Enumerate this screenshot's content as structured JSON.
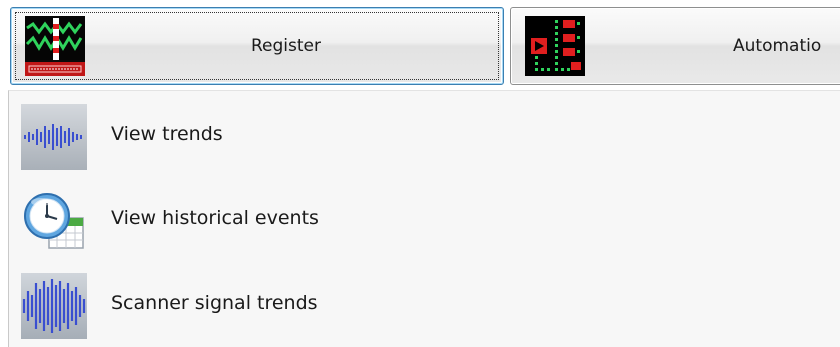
{
  "toolbar": {
    "buttons": [
      {
        "label": "Register",
        "icon": "register-signal-icon",
        "state": "focused"
      },
      {
        "label": "Automatio",
        "icon": "automation-icon",
        "state": "normal"
      }
    ]
  },
  "menu": {
    "items": [
      {
        "label": "View trends",
        "icon": "waveform-trend-icon"
      },
      {
        "label": "View historical events",
        "icon": "clock-calendar-icon"
      },
      {
        "label": "Scanner signal trends",
        "icon": "scanner-waveform-icon"
      }
    ]
  },
  "colors": {
    "focus_border": "#3c7fb1",
    "menu_background": "#f7f7f7",
    "waveform_blue": "#3a4fd0",
    "icon_black": "#000000",
    "icon_green": "#2fd35c",
    "icon_red": "#e01f1f"
  }
}
